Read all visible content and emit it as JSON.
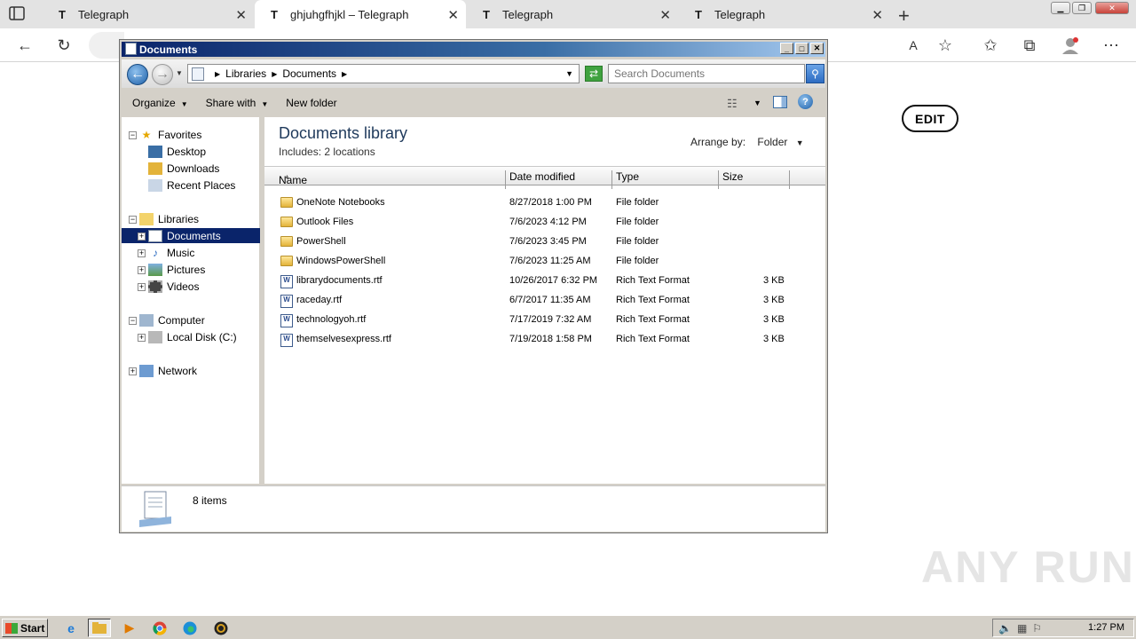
{
  "browser": {
    "tabs": [
      {
        "favicon": "T",
        "label": "Telegraph",
        "active": false
      },
      {
        "favicon": "T",
        "label": "ghjuhgfhjkl – Telegraph",
        "active": true
      },
      {
        "favicon": "T",
        "label": "Telegraph",
        "active": false
      },
      {
        "favicon": "T",
        "label": "Telegraph",
        "active": false
      }
    ],
    "edit_button": "EDIT"
  },
  "explorer": {
    "title": "Documents",
    "breadcrumb": [
      "Libraries",
      "Documents"
    ],
    "search_placeholder": "Search Documents",
    "commands": [
      "Organize",
      "Share with",
      "New folder"
    ],
    "nav": {
      "favorites": {
        "label": "Favorites",
        "items": [
          "Desktop",
          "Downloads",
          "Recent Places"
        ]
      },
      "libraries": {
        "label": "Libraries",
        "items": [
          "Documents",
          "Music",
          "Pictures",
          "Videos"
        ]
      },
      "computer": {
        "label": "Computer",
        "items": [
          "Local Disk (C:)"
        ]
      },
      "network": {
        "label": "Network"
      }
    },
    "library_title": "Documents library",
    "library_includes": "Includes:  2 locations",
    "arrange_by_label": "Arrange by:",
    "arrange_by_value": "Folder",
    "columns": [
      "Name",
      "Date modified",
      "Type",
      "Size"
    ],
    "files": [
      {
        "name": "OneNote Notebooks",
        "date": "8/27/2018 1:00 PM",
        "type": "File folder",
        "size": "",
        "kind": "folder"
      },
      {
        "name": "Outlook Files",
        "date": "7/6/2023 4:12 PM",
        "type": "File folder",
        "size": "",
        "kind": "folder"
      },
      {
        "name": "PowerShell",
        "date": "7/6/2023 3:45 PM",
        "type": "File folder",
        "size": "",
        "kind": "folder"
      },
      {
        "name": "WindowsPowerShell",
        "date": "7/6/2023 11:25 AM",
        "type": "File folder",
        "size": "",
        "kind": "folder"
      },
      {
        "name": "librarydocuments.rtf",
        "date": "10/26/2017 6:32 PM",
        "type": "Rich Text Format",
        "size": "3 KB",
        "kind": "rtf"
      },
      {
        "name": "raceday.rtf",
        "date": "6/7/2017 11:35 AM",
        "type": "Rich Text Format",
        "size": "3 KB",
        "kind": "rtf"
      },
      {
        "name": "technologyoh.rtf",
        "date": "7/17/2019 7:32 AM",
        "type": "Rich Text Format",
        "size": "3 KB",
        "kind": "rtf"
      },
      {
        "name": "themselvesexpress.rtf",
        "date": "7/19/2018 1:58 PM",
        "type": "Rich Text Format",
        "size": "3 KB",
        "kind": "rtf"
      }
    ],
    "status": "8 items"
  },
  "taskbar": {
    "start_label": "Start",
    "clock": "1:27 PM"
  },
  "watermark": "ANY RUN"
}
